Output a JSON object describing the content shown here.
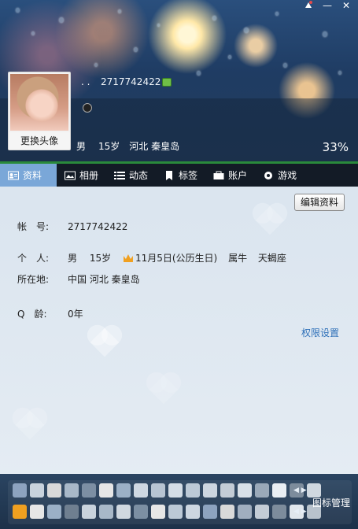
{
  "window": {
    "skin_label": "",
    "minimize": "—",
    "close": "✕"
  },
  "header": {
    "nickname": ". .",
    "qq_number": "2717742422",
    "change_avatar": "更换头像",
    "gender": "男",
    "age": "15岁",
    "location": "河北 秦皇岛",
    "percent": "33%"
  },
  "tabs": [
    {
      "label": "资料",
      "icon": "profile-card-icon"
    },
    {
      "label": "相册",
      "icon": "photo-icon"
    },
    {
      "label": "动态",
      "icon": "feed-list-icon"
    },
    {
      "label": "标签",
      "icon": "bookmark-icon"
    },
    {
      "label": "账户",
      "icon": "wallet-icon"
    },
    {
      "label": "游戏",
      "icon": "game-icon"
    }
  ],
  "profile": {
    "edit_button": "编辑资料",
    "account_label": "帐　号:",
    "account_value": "2717742422",
    "personal_label": "个　人:",
    "personal_gender": "男",
    "personal_age": "15岁",
    "birthday": "11月5日(公历生日)",
    "zodiac": "属牛",
    "constellation": "天蝎座",
    "location_label": "所在地:",
    "location_value": "中国 河北 秦皇岛",
    "qage_label": "Q　龄:",
    "qage_value": "0年",
    "permission_link": "权限设置"
  },
  "iconbar": {
    "manage_label": "图标管理",
    "prev_next": "◀ ▶",
    "row1_colors": [
      "#8da3bf",
      "#c9d3dd",
      "#d9d9d9",
      "#a8b8c8",
      "#7c8fa3",
      "#e6e6e6",
      "#9bb0c6",
      "#cfd8e2",
      "#b7c4d2",
      "#d4dde6",
      "#bcc9d6",
      "#cdd6e0",
      "#c3ccd6",
      "#d8e0e8",
      "#9aa9b9",
      "#e9eef3",
      "#7d8c9c",
      "#d0d8e0"
    ],
    "row2_colors": [
      "#f0a020",
      "#e6e6e6",
      "#9bb0c6",
      "#6f7f90",
      "#c9d3dd",
      "#a8b8c8",
      "#d0d8e0",
      "#7c8fa3",
      "#e6e6e6",
      "#bcc9d6",
      "#cdd6e0",
      "#8da3bf",
      "#d9d9d9",
      "#a0aebf",
      "#c3ccd6",
      "#7d8c9c",
      "#e0e6ec",
      "#b8c2cc"
    ],
    "brand_colors": {
      "tab_active": "#7aa7d8",
      "link": "#2d6fb8",
      "tab_bar": "#131b26"
    }
  }
}
